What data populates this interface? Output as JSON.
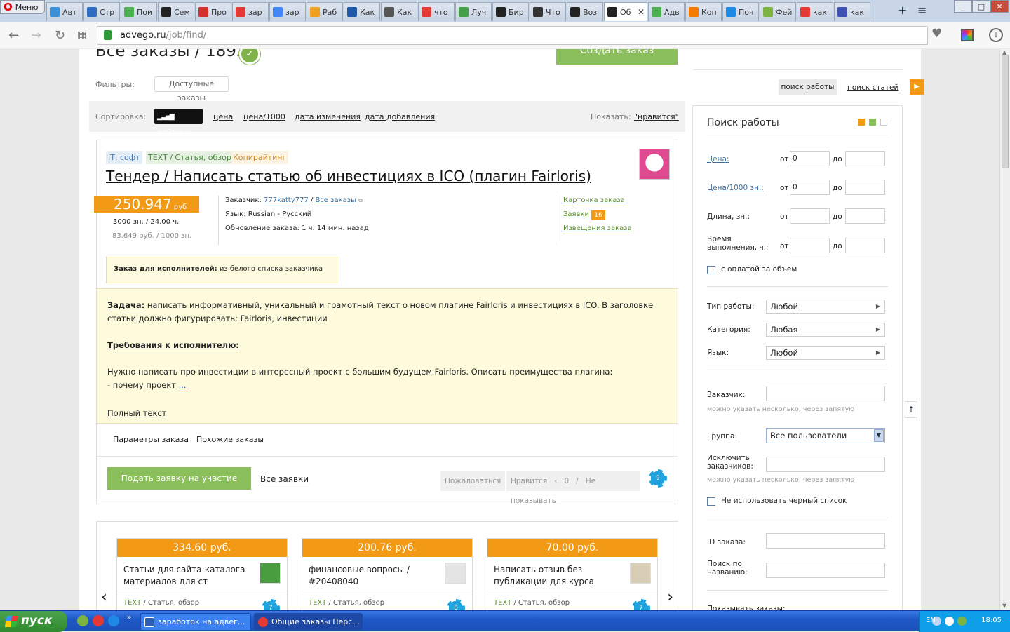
{
  "browser": {
    "menu_label": "Меню",
    "tabs": [
      {
        "label": "Авт",
        "icon": "opera-icon",
        "color": "#3a8fd9"
      },
      {
        "label": "Стр",
        "icon": "globe-icon",
        "color": "#2d6cc0"
      },
      {
        "label": "Пои",
        "icon": "butterfly-icon",
        "color": "#4caf50"
      },
      {
        "label": "Сем",
        "icon": "advego-icon",
        "color": "#222222"
      },
      {
        "label": "Про",
        "icon": "copyright-icon",
        "color": "#d32f2f"
      },
      {
        "label": "зар",
        "icon": "yandex-icon",
        "color": "#e53935"
      },
      {
        "label": "зар",
        "icon": "google-icon",
        "color": "#4285f4"
      },
      {
        "label": "Раб",
        "icon": "etxt-icon",
        "color": "#f0a020"
      },
      {
        "label": "Как",
        "icon": "box-icon",
        "color": "#1e5aa8"
      },
      {
        "label": "Как",
        "icon": "bird-icon",
        "color": "#555555"
      },
      {
        "label": "что",
        "icon": "yandex-icon",
        "color": "#e53935"
      },
      {
        "label": "Луч",
        "icon": "leaf-icon",
        "color": "#43a047"
      },
      {
        "label": "Бир",
        "icon": "advego-icon",
        "color": "#222222"
      },
      {
        "label": "Что",
        "icon": "mountain-icon",
        "color": "#333333"
      },
      {
        "label": "Воз",
        "icon": "advego-icon",
        "color": "#222222"
      },
      {
        "label": "Об",
        "icon": "advego-icon",
        "color": "#222222",
        "active": true
      },
      {
        "label": "Адв",
        "icon": "pencil-icon",
        "color": "#4caf50"
      },
      {
        "label": "Коп",
        "icon": "bars-icon",
        "color": "#f57c00"
      },
      {
        "label": "Поч",
        "icon": "at-icon",
        "color": "#1e88e5"
      },
      {
        "label": "Фей",
        "icon": "b-icon",
        "color": "#7cb342"
      },
      {
        "label": "как",
        "icon": "yandex-icon",
        "color": "#e53935"
      },
      {
        "label": "как",
        "icon": "picture-icon",
        "color": "#3f51b5"
      }
    ],
    "url_host": "advego.ru",
    "url_path": "/job/find/"
  },
  "page": {
    "title": "Все заказы / 1892",
    "create_button": "Создать заказ",
    "filters_label": "Фильтры:",
    "filter_chip": "Доступные заказы",
    "sort_label": "Сортировка:",
    "sort_active": "рейтинг",
    "sort_links": [
      "цена",
      "цена/1000",
      "дата изменения",
      "дата добавления"
    ],
    "show_label": "Показать:",
    "show_value": "\"нравится\""
  },
  "job": {
    "tags": [
      "IT, софт",
      "TEXT / Статья, обзор",
      "Копирайтинг"
    ],
    "title": "Тендер / Написать статью об инвестициях в ICO (плагин Fairloris)",
    "price": "250.947",
    "price_unit": "руб",
    "chars_time": "3000 зн. / 24.00 ч.",
    "per_1000": "83.649 руб. / 1000 зн.",
    "customer_label": "Заказчик:",
    "customer": "777katty777",
    "all_orders": "Все заказы",
    "lang_line": "Язык: Russian - Русский",
    "update_line": "Обновление заказа: 1 ч. 14 мин. назад",
    "card_link": "Карточка заказа",
    "bids_link": "Заявки",
    "bids_count": "16",
    "notices_link": "Извещения заказа",
    "executor_label": "Заказ для исполнителей:",
    "executor_value": "из белого списка заказчика",
    "task_label": "Задача:",
    "task_text": "написать информативный, уникальный и грамотный текст о новом плагине Fairloris и инвестициях в ICO. В заголовке статьи должно фигурировать: Fairloris, инвестиции",
    "req_label": "Требования к исполнителю:",
    "req_text": "Нужно написать про инвестиции в интересный проект с большим будущем Fairloris. Описать преимущества плагина:",
    "req_item": "- почему проект",
    "more": "...",
    "full_text": "Полный текст",
    "params_link": "Параметры заказа",
    "similar_link": "Похожие заказы",
    "apply_button": "Подать заявку на участие",
    "all_bids": "Все заявки",
    "complain": "Пожаловаться",
    "like": "Нравится",
    "like_count": "0",
    "hide": "Не показывать",
    "badge": "9"
  },
  "carousel": [
    {
      "price": "334.60 руб.",
      "title": "Статьи для сайта-каталога материалов для ст",
      "type_a": "TEXT",
      "type_b": "/ Статья, обзор",
      "badge": "7"
    },
    {
      "price": "200.76 руб.",
      "title": "финансовые вопросы / #20408040",
      "type_a": "TEXT",
      "type_b": "/ Статья, обзор",
      "badge": "8"
    },
    {
      "price": "70.00 руб.",
      "title": "Написать отзыв без публикации для курса",
      "type_a": "TEXT",
      "type_b": "/ Статья, обзор",
      "badge": "7"
    }
  ],
  "sidebar": {
    "tab_jobs": "поиск работы",
    "tab_articles": "поиск статей",
    "title": "Поиск работы",
    "price_label": "Цена:",
    "price1000_label": "Цена/1000 зн.:",
    "length_label": "Длина, зн.:",
    "time_label_1": "Время",
    "time_label_2": "выполнения, ч.:",
    "from": "от",
    "to": "до",
    "price_from": "0",
    "price1000_from": "0",
    "volume_pay": "с оплатой за объем",
    "work_type_label": "Тип работы:",
    "work_type": "Любой",
    "category_label": "Категория:",
    "category": "Любая",
    "language_label": "Язык:",
    "language": "Любой",
    "customer_label": "Заказчик:",
    "hint": "можно указать несколько, через запятую",
    "group_label": "Группа:",
    "group_value": "Все пользователи",
    "exclude_label_1": "Исключить",
    "exclude_label_2": "заказчиков:",
    "blacklist": "Не использовать черный список",
    "id_label": "ID заказа:",
    "name_label_1": "Поиск по",
    "name_label_2": "названию:",
    "show_orders": "Показывать заказы:"
  },
  "taskbar": {
    "start": "пуск",
    "tasks": [
      "заработок на адвег...",
      "Общие заказы Перс..."
    ],
    "lang": "EN",
    "time": "18:05"
  }
}
